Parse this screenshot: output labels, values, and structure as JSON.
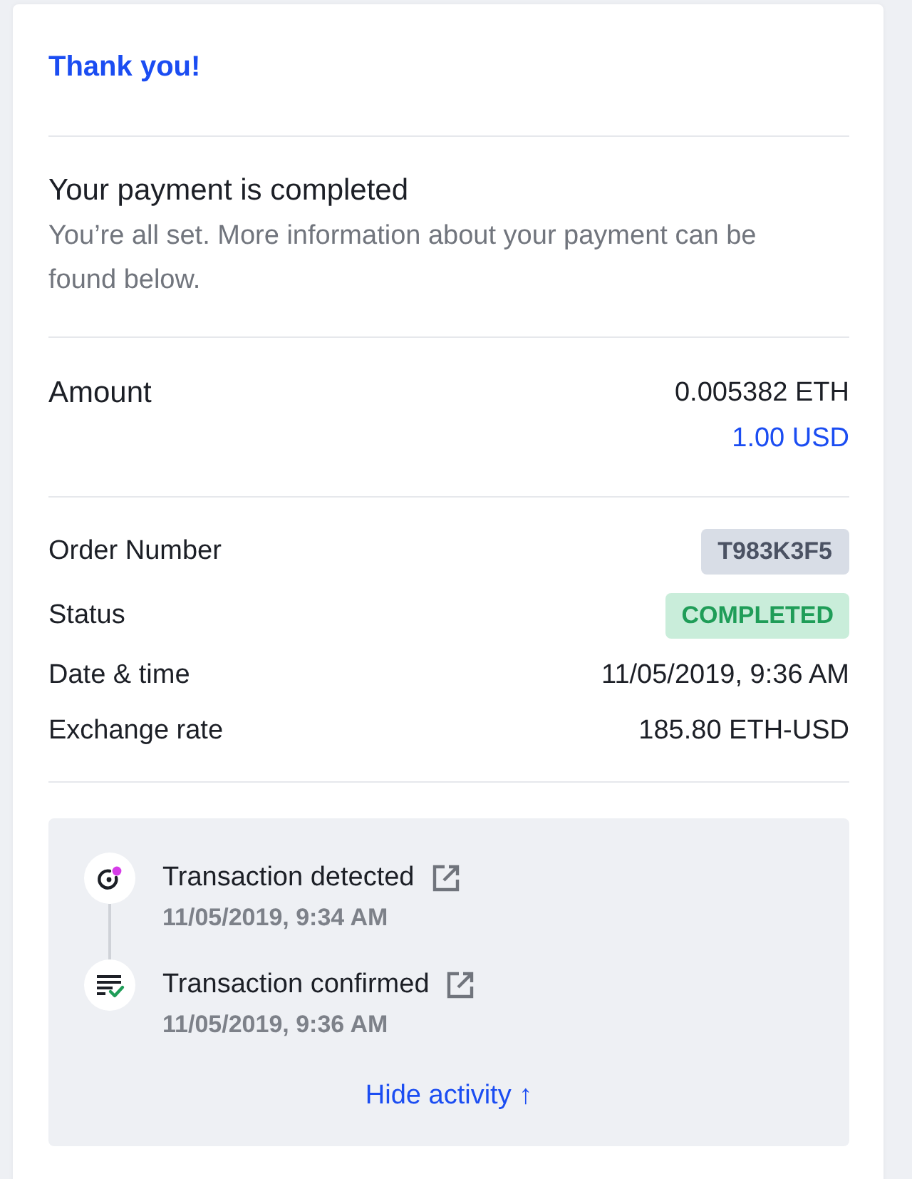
{
  "header": {
    "title": "Thank you!"
  },
  "message": {
    "heading": "Your payment is completed",
    "text": "You’re all set. More information about your payment can be found below."
  },
  "amount": {
    "label": "Amount",
    "crypto": "0.005382 ETH",
    "fiat": "1.00 USD"
  },
  "details": [
    {
      "label": "Order Number",
      "value": "T983K3F5",
      "kind": "tag"
    },
    {
      "label": "Status",
      "value": "COMPLETED",
      "kind": "status"
    },
    {
      "label": "Date & time",
      "value": "11/05/2019, 9:36 AM",
      "kind": "text"
    },
    {
      "label": "Exchange rate",
      "value": "185.80 ETH-USD",
      "kind": "text"
    }
  ],
  "activity": {
    "expanded": true,
    "events": [
      {
        "kind": "detected",
        "title": "Transaction detected",
        "time": "11/05/2019, 9:34 AM"
      },
      {
        "kind": "confirmed",
        "title": "Transaction confirmed",
        "time": "11/05/2019, 9:36 AM"
      }
    ],
    "toggle": "Hide activity ↑"
  }
}
